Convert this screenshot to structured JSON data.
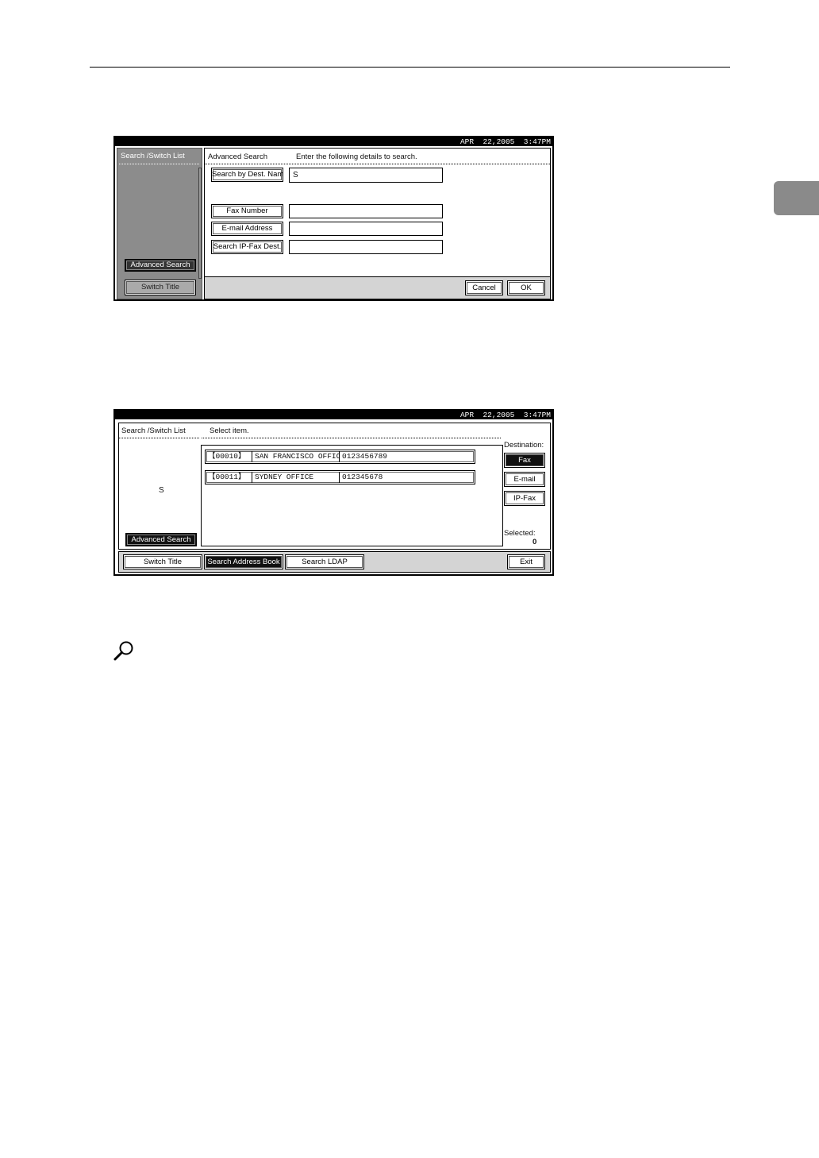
{
  "icons": {
    "reference": "magnifier-icon"
  },
  "screen1": {
    "datetime": "APR  22,2005  3:47PM",
    "left_title": "Search /Switch List",
    "advanced_search_label": "Advanced Search",
    "switch_title_label": "Switch Title",
    "header_title": "Advanced Search",
    "header_instruction": "Enter the following details to search.",
    "search_by_name_label": "Search by Dest. Name",
    "search_by_name_value": "S",
    "fax_number_label": "Fax Number",
    "fax_number_value": "",
    "email_address_label": "E-mail Address",
    "email_address_value": "",
    "search_ipfax_label": "Search IP-Fax Dest.",
    "search_ipfax_value": "",
    "cancel_label": "Cancel",
    "ok_label": "OK"
  },
  "screen2": {
    "datetime": "APR  22,2005  3:47PM",
    "left_title": "Search /Switch List",
    "instruction": "Select item.",
    "search_key": "S",
    "advanced_search_label": "Advanced Search",
    "destination_label": "Destination:",
    "dest_types": [
      "Fax",
      "E-mail",
      "IP-Fax"
    ],
    "selected_label": "Selected:",
    "selected_count": "0",
    "results": [
      {
        "id": "【00010】",
        "name": "SAN FRANCISCO OFFICE",
        "number": "0123456789"
      },
      {
        "id": "【00011】",
        "name": "SYDNEY OFFICE",
        "number": "012345678"
      }
    ],
    "switch_title_label": "Switch Title",
    "search_address_book_label": "Search Address Book",
    "search_ldap_label": "Search LDAP",
    "exit_label": "Exit"
  }
}
